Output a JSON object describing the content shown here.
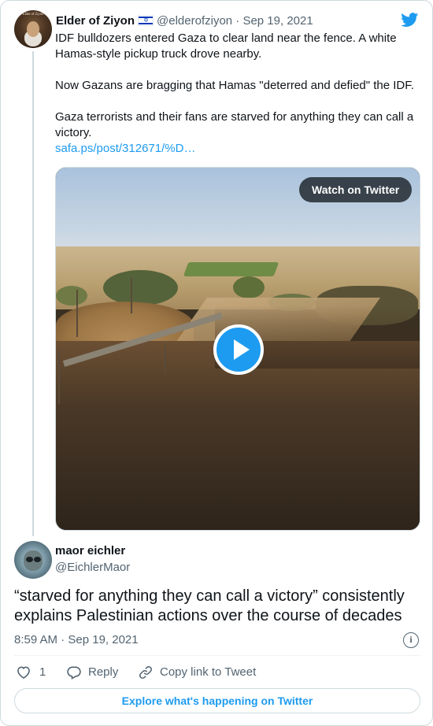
{
  "parent_tweet": {
    "avatar_caption": "Elder of Ziyon",
    "author_name": "Elder of Ziyon",
    "flag_icon": "israel-flag-icon",
    "handle_date": "@elderofziyon · Sep 19, 2021",
    "paragraphs": [
      "IDF bulldozers entered Gaza to clear land near the fence. A white Hamas-style pickup truck drove nearby.",
      "Now Gazans are bragging that Hamas \"deterred and defied\" the IDF.",
      "Gaza terrorists and their fans are starved for anything they can call a victory."
    ],
    "link_text": "safa.ps/post/312671/%D…",
    "media": {
      "watch_label": "Watch on Twitter",
      "play_icon": "play-icon"
    }
  },
  "reply_tweet": {
    "author_name": "maor eichler",
    "handle": "@EichlerMaor",
    "text": "“starved for anything they can call a victory” consistently explains Palestinian actions over the course of decades",
    "timestamp": "8:59 AM · Sep 19, 2021"
  },
  "actions": {
    "like_count": "1",
    "reply_label": "Reply",
    "copy_label": "Copy link to Tweet"
  },
  "explore_label": "Explore what's happening on Twitter",
  "colors": {
    "twitter_blue": "#1d9bf0",
    "text": "#0f1419",
    "muted": "#536471",
    "border": "#cfd9de"
  }
}
